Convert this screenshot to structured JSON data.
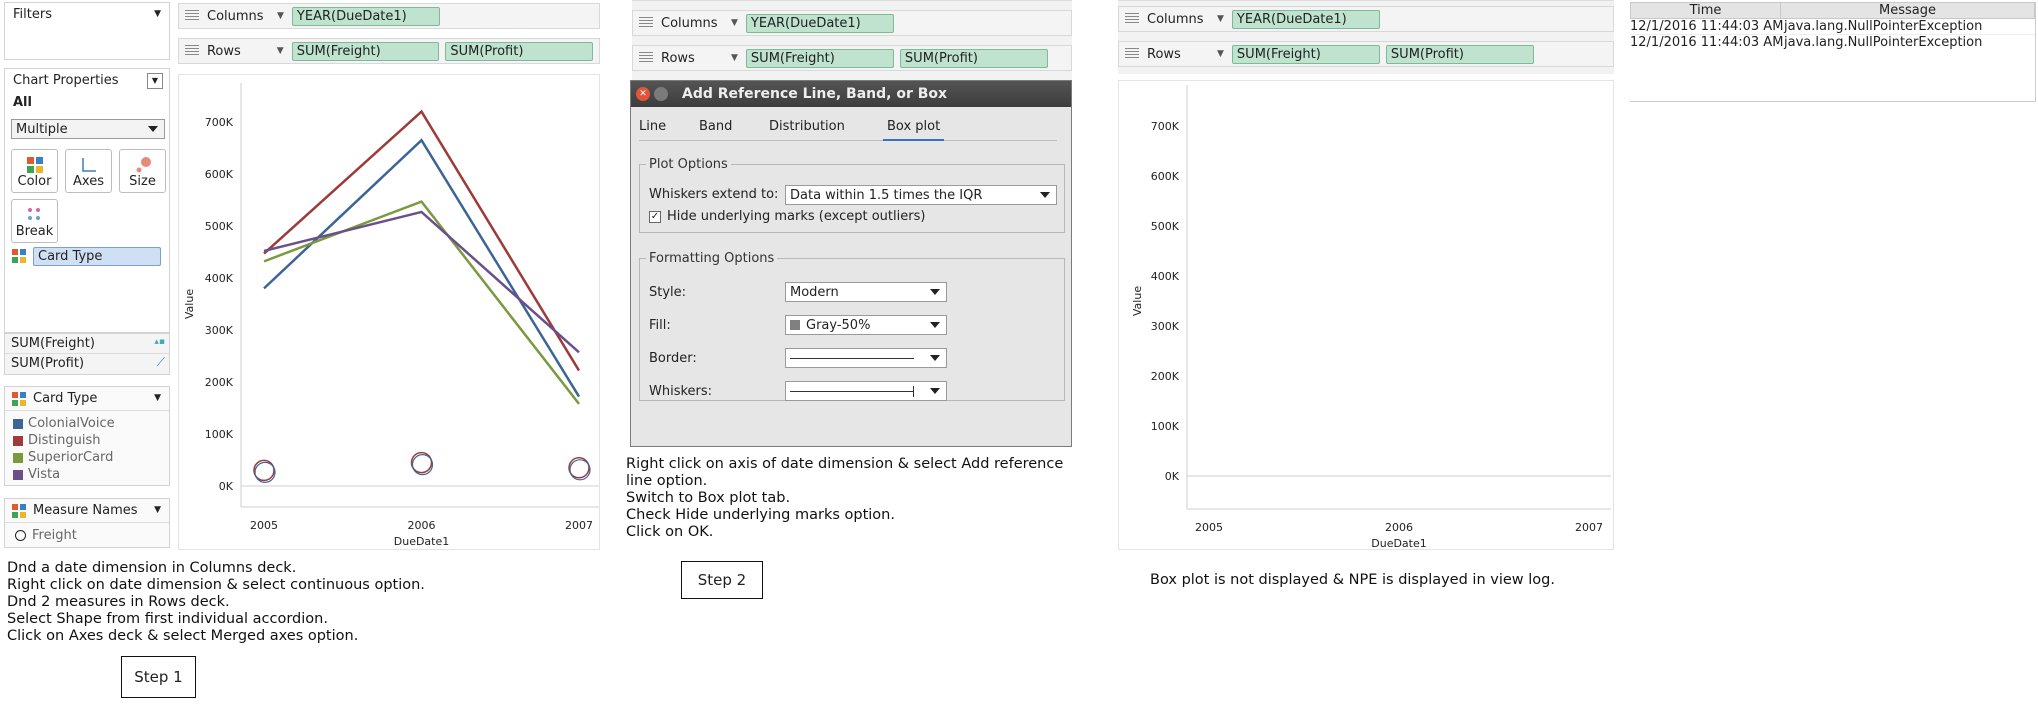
{
  "step1": {
    "filters_label": "Filters",
    "columns_label": "Columns",
    "columns_pill": "YEAR(DueDate1)",
    "rows_label": "Rows",
    "rows_pills": [
      "SUM(Freight)",
      "SUM(Profit)"
    ],
    "chart_properties_label": "Chart Properties",
    "all_label": "All",
    "multiple_value": "Multiple",
    "buttons": [
      "Color",
      "Axes",
      "Size",
      "Break"
    ],
    "card_type_pill": "Card Type",
    "measures": [
      "SUM(Freight)",
      "SUM(Profit)"
    ],
    "legend_title": "Card Type",
    "legend_items": [
      "ColonialVoice",
      "Distinguish",
      "SuperiorCard",
      "Vista"
    ],
    "measure_names_title": "Measure Names",
    "measure_names_item": "Freight",
    "caption": "Dnd a date dimension in Columns deck.\nRight click on date dimension & select continuous option.\nDnd 2 measures in Rows deck.\nSelect Shape from first individual accordion.\nClick on Axes deck & select Merged axes option.",
    "step_label": "Step 1"
  },
  "chart_data": [
    {
      "type": "line",
      "xlabel": "DueDate1",
      "ylabel": "Value",
      "x": [
        2005,
        2006,
        2007
      ],
      "y_ticks": [
        "0K",
        "100K",
        "200K",
        "300K",
        "400K",
        "500K",
        "600K",
        "700K"
      ],
      "ylim": [
        0,
        700000
      ],
      "grid": false,
      "series": [
        {
          "color": "#3c6496",
          "values": [
            380000,
            665000,
            172000
          ]
        },
        {
          "color": "#9e3a3a",
          "values": [
            447000,
            720000,
            222000
          ]
        },
        {
          "color": "#7a9a40",
          "values": [
            432000,
            547000,
            158000
          ]
        },
        {
          "color": "#6a4f8a",
          "values": [
            452000,
            527000,
            257000
          ]
        }
      ],
      "outlier_circles_y": [
        30000,
        45000,
        35000
      ]
    },
    {
      "type": "line",
      "xlabel": "DueDate1",
      "ylabel": "Value",
      "x": [
        2005,
        2006,
        2007
      ],
      "y_ticks": [
        "0K",
        "100K",
        "200K",
        "300K",
        "400K",
        "500K",
        "600K",
        "700K"
      ],
      "ylim": [
        0,
        700000
      ],
      "grid": false,
      "series": []
    }
  ],
  "step2": {
    "columns_label": "Columns",
    "columns_pill": "YEAR(DueDate1)",
    "rows_label": "Rows",
    "rows_pills": [
      "SUM(Freight)",
      "SUM(Profit)"
    ],
    "dialog_title": "Add Reference Line, Band, or Box",
    "tabs": [
      "Line",
      "Band",
      "Distribution",
      "Box plot"
    ],
    "plot_options_title": "Plot Options",
    "whiskers_label": "Whiskers extend to:",
    "whiskers_value": "Data within 1.5 times the IQR",
    "hide_marks_label": "Hide underlying marks (except outliers)",
    "formatting_title": "Formatting Options",
    "style_label": "Style:",
    "style_value": "Modern",
    "fill_label": "Fill:",
    "fill_value": "Gray-50%",
    "border_label": "Border:",
    "whiskers2_label": "Whiskers:",
    "caption": "Right click on axis of date dimension & select Add reference\nline option.\nSwitch to Box plot tab.\nCheck Hide underlying marks option.\nClick on OK.",
    "step_label": "Step 2"
  },
  "step3": {
    "columns_label": "Columns",
    "columns_pill": "YEAR(DueDate1)",
    "rows_label": "Rows",
    "rows_pills": [
      "SUM(Freight)",
      "SUM(Profit)"
    ],
    "caption": "Box plot is not displayed & NPE is displayed in view log."
  },
  "log": {
    "headers": [
      "Time",
      "Message"
    ],
    "rows": [
      [
        "12/1/2016 11:44:03 AM",
        "java.lang.NullPointerException"
      ],
      [
        "12/1/2016 11:44:03 AM",
        "java.lang.NullPointerException"
      ]
    ]
  }
}
